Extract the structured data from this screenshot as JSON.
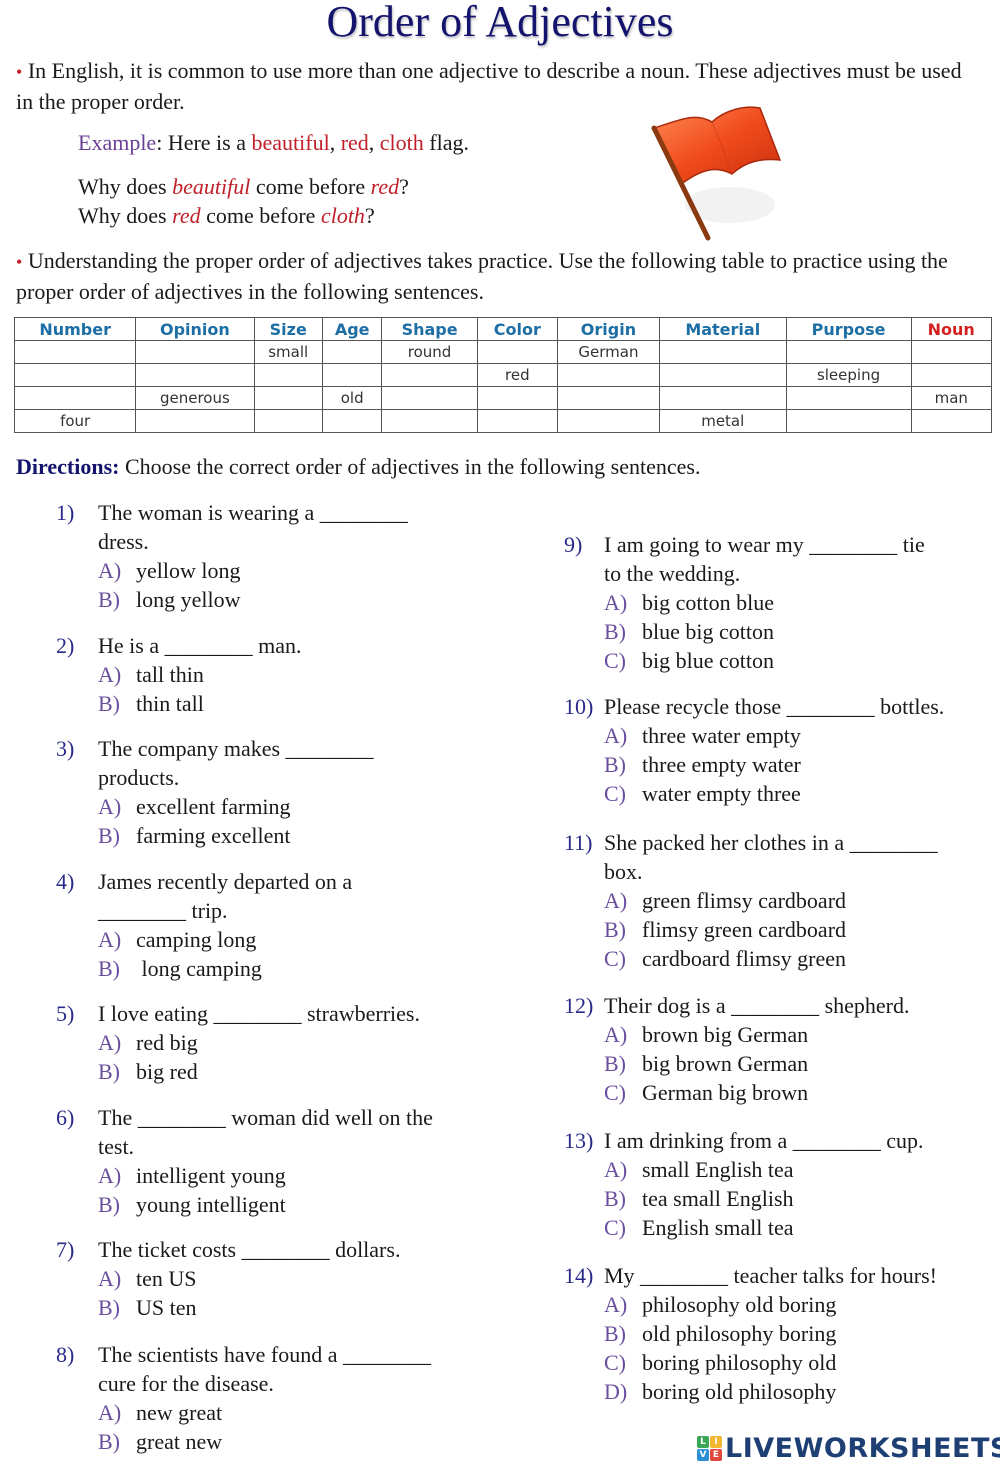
{
  "title": "Order of Adjectives",
  "intro": {
    "bullet1": "In English, it is common to use more than one adjective to describe a noun. These adjectives must be used in the proper order.",
    "example_label": "Example",
    "example_pre": ": Here is a ",
    "example_adj1": "beautiful",
    "example_comma1": ", ",
    "example_adj2": "red",
    "example_comma2": ", ",
    "example_adj3": "cloth",
    "example_post": " flag.",
    "why1_pre": "Why does ",
    "why1_a": "beautiful",
    "why1_mid": " come before ",
    "why1_b": "red",
    "why1_end": "?",
    "why2_pre": "Why does ",
    "why2_a": "red",
    "why2_mid": " come before ",
    "why2_b": "cloth",
    "why2_end": "?",
    "bullet2": "Understanding the proper order of adjectives takes practice. Use the following table to practice using the proper order of adjectives in the following sentences.",
    "image": "red-flag-icon"
  },
  "table": {
    "headers": [
      "Number",
      "Opinion",
      "Size",
      "Age",
      "Shape",
      "Color",
      "Origin",
      "Material",
      "Purpose",
      "Noun"
    ],
    "rows": [
      [
        "",
        "",
        "small",
        "",
        "round",
        "",
        "German",
        "",
        "",
        ""
      ],
      [
        "",
        "",
        "",
        "",
        "",
        "red",
        "",
        "",
        "sleeping",
        ""
      ],
      [
        "",
        "generous",
        "",
        "old",
        "",
        "",
        "",
        "",
        "",
        "man"
      ],
      [
        "four",
        "",
        "",
        "",
        "",
        "",
        "",
        "metal",
        "",
        ""
      ]
    ]
  },
  "directions": {
    "label": "Directions:",
    "text": " Choose the correct order of adjectives in the following sentences."
  },
  "questions": [
    {
      "num": "1)",
      "lines": [
        "The woman is wearing a ________",
        "dress."
      ],
      "options": [
        [
          "A)",
          "yellow long"
        ],
        [
          "B)",
          "long yellow"
        ]
      ]
    },
    {
      "num": "2)",
      "lines": [
        "He is a ________ man."
      ],
      "options": [
        [
          "A)",
          "tall thin"
        ],
        [
          "B)",
          "thin tall"
        ]
      ]
    },
    {
      "num": "3)",
      "lines": [
        "The company makes ________",
        "products."
      ],
      "options": [
        [
          "A)",
          "excellent farming"
        ],
        [
          "B)",
          "farming excellent"
        ]
      ]
    },
    {
      "num": "4)",
      "lines": [
        "James recently departed on a",
        "________ trip."
      ],
      "options": [
        [
          "A)",
          "camping long"
        ],
        [
          "B)",
          " long camping"
        ]
      ]
    },
    {
      "num": "5)",
      "lines": [
        "I love eating ________ strawberries."
      ],
      "options": [
        [
          "A)",
          "red big"
        ],
        [
          "B)",
          "big red"
        ]
      ]
    },
    {
      "num": "6)",
      "lines": [
        "The ________ woman did well on the",
        "test."
      ],
      "options": [
        [
          "A)",
          "intelligent young"
        ],
        [
          "B)",
          "young intelligent"
        ]
      ]
    },
    {
      "num": "7)",
      "lines": [
        "The ticket costs ________ dollars."
      ],
      "options": [
        [
          "A)",
          "ten US"
        ],
        [
          "B)",
          "US ten"
        ]
      ]
    },
    {
      "num": "8)",
      "lines": [
        "The scientists have found a ________",
        "cure for the disease."
      ],
      "options": [
        [
          "A)",
          "new great"
        ],
        [
          "B)",
          "great new"
        ]
      ]
    },
    {
      "num": "9)",
      "lines": [
        "I am going to wear my ________ tie",
        "to the wedding."
      ],
      "options": [
        [
          "A)",
          "big cotton blue"
        ],
        [
          "B)",
          "blue big cotton"
        ],
        [
          "C)",
          "big blue cotton"
        ]
      ]
    },
    {
      "num": "10)",
      "lines": [
        "Please recycle those ________ bottles."
      ],
      "options": [
        [
          "A)",
          "three water empty"
        ],
        [
          "B)",
          "three empty water"
        ],
        [
          "C)",
          "water empty three"
        ]
      ]
    },
    {
      "num": "11)",
      "lines": [
        "She packed her clothes in a ________",
        "box."
      ],
      "options": [
        [
          "A)",
          "green flimsy cardboard"
        ],
        [
          "B)",
          "flimsy green cardboard"
        ],
        [
          "C)",
          "cardboard flimsy green"
        ]
      ]
    },
    {
      "num": "12)",
      "lines": [
        "Their dog is a ________ shepherd."
      ],
      "options": [
        [
          "A)",
          "brown big German"
        ],
        [
          "B)",
          "big brown German"
        ],
        [
          "C)",
          "German big brown"
        ]
      ]
    },
    {
      "num": "13)",
      "lines": [
        "I am drinking from a ________ cup."
      ],
      "options": [
        [
          "A)",
          "small English tea"
        ],
        [
          "B)",
          "tea small English"
        ],
        [
          "C)",
          "English small tea"
        ]
      ]
    },
    {
      "num": "14)",
      "lines": [
        "My ________ teacher talks for hours!"
      ],
      "options": [
        [
          "A)",
          "philosophy old boring"
        ],
        [
          "B)",
          "old philosophy boring"
        ],
        [
          "C)",
          "boring philosophy old"
        ],
        [
          "D)",
          "boring old philosophy"
        ]
      ]
    }
  ],
  "footer": {
    "logo_letters": [
      "L",
      "I",
      "V",
      "E"
    ],
    "logo_colors": [
      "#3aa757",
      "#f2b631",
      "#2b8fd6",
      "#e0483e"
    ],
    "logo_text": "LIVEWORKSHEETS"
  }
}
